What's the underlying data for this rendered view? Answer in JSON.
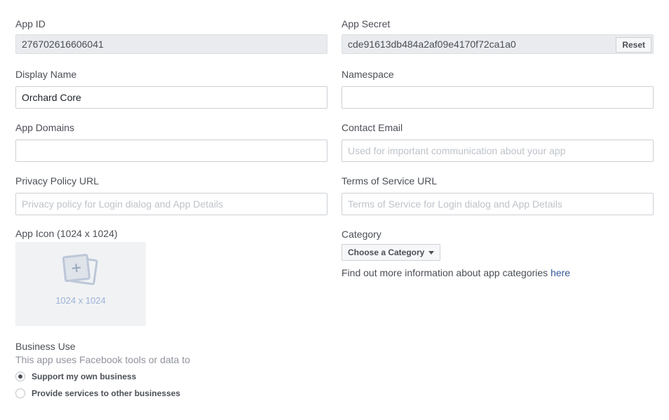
{
  "app_id": {
    "label": "App ID",
    "value": "276702616606041"
  },
  "app_secret": {
    "label": "App Secret",
    "value": "cde91613db484a2af09e4170f72ca1a0",
    "reset_label": "Reset"
  },
  "display_name": {
    "label": "Display Name",
    "value": "Orchard Core"
  },
  "namespace": {
    "label": "Namespace",
    "value": ""
  },
  "app_domains": {
    "label": "App Domains",
    "value": ""
  },
  "contact_email": {
    "label": "Contact Email",
    "placeholder": "Used for important communication about your app"
  },
  "privacy_policy": {
    "label": "Privacy Policy URL",
    "placeholder": "Privacy policy for Login dialog and App Details"
  },
  "terms_of_service": {
    "label": "Terms of Service URL",
    "placeholder": "Terms of Service for Login dialog and App Details"
  },
  "app_icon": {
    "label": "App Icon (1024 x 1024)",
    "dimensions": "1024 x 1024"
  },
  "category": {
    "label": "Category",
    "button_label": "Choose a Category",
    "info_text": "Find out more information about app categories ",
    "info_link": "here"
  },
  "business_use": {
    "label": "Business Use",
    "description": "This app uses Facebook tools or data to",
    "options": [
      {
        "label": "Support my own business",
        "checked": true
      },
      {
        "label": "Provide services to other businesses",
        "checked": false
      }
    ]
  }
}
